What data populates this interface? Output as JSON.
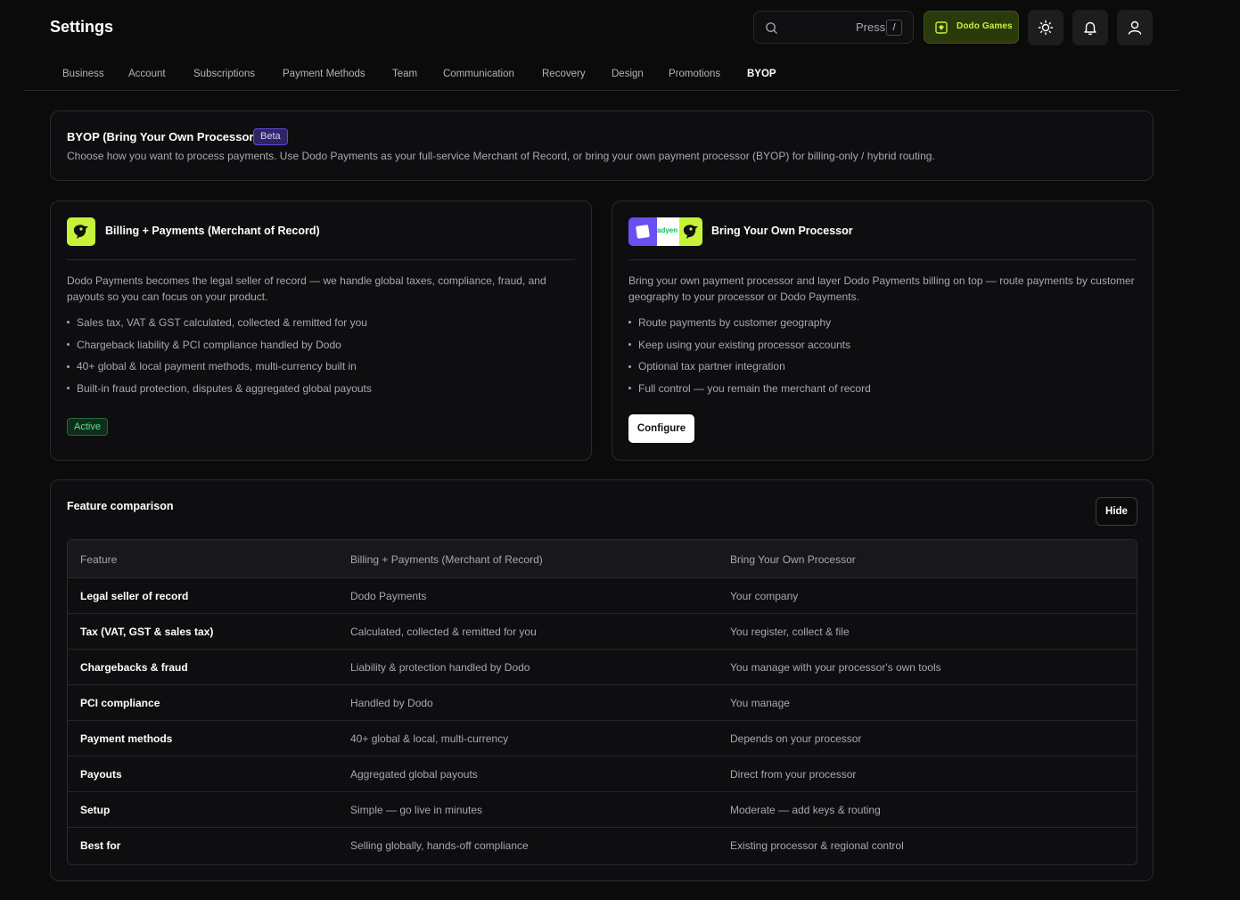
{
  "header": {
    "title": "Settings",
    "search": {
      "hint": "Press",
      "shortcut": "/"
    },
    "workspace": {
      "label": "Dodo Games"
    }
  },
  "tabs": [
    {
      "label": "Business"
    },
    {
      "label": "Account"
    },
    {
      "label": "Subscriptions"
    },
    {
      "label": "Payment Methods"
    },
    {
      "label": "Team"
    },
    {
      "label": "Communication"
    },
    {
      "label": "Recovery"
    },
    {
      "label": "Design"
    },
    {
      "label": "Promotions"
    },
    {
      "label": "BYOP",
      "active": true
    }
  ],
  "intro": {
    "title": "BYOP (Bring Your Own Processor)",
    "badge": "Beta",
    "description": "Choose how you want to process payments. Use Dodo Payments as your full-service Merchant of Record, or bring your own payment processor (BYOP) for billing-only / hybrid routing."
  },
  "options": {
    "mor": {
      "title": "Billing + Payments (Merchant of Record)",
      "description": "Dodo Payments becomes the legal seller of record — we handle global taxes, compliance, fraud, and payouts so you can focus on your product.",
      "bullets": [
        "Sales tax, VAT & GST calculated, collected & remitted for you",
        "Chargeback liability & PCI compliance handled by Dodo",
        "40+ global & local payment methods, multi-currency built in",
        "Built-in fraud protection, disputes & aggregated global payouts"
      ],
      "status": "Active"
    },
    "byop": {
      "title": "Bring Your Own Processor",
      "logo_text": "adyen",
      "description": "Bring your own payment processor and layer Dodo Payments billing on top — route payments by customer geography to your processor or Dodo Payments.",
      "bullets": [
        "Route payments by customer geography",
        "Keep using your existing processor accounts",
        "Optional tax partner integration",
        "Full control — you remain the merchant of record"
      ],
      "button": "Configure"
    }
  },
  "comparison": {
    "title": "Feature comparison",
    "toggle": "Hide",
    "columns": [
      "Feature",
      "Billing + Payments (Merchant of Record)",
      "Bring Your Own Processor"
    ],
    "rows": [
      [
        "Legal seller of record",
        "Dodo Payments",
        "Your company"
      ],
      [
        "Tax (VAT, GST & sales tax)",
        "Calculated, collected & remitted for you",
        "You register, collect & file"
      ],
      [
        "Chargebacks & fraud",
        "Liability & protection handled by Dodo",
        "You manage with your processor's own tools"
      ],
      [
        "PCI compliance",
        "Handled by Dodo",
        "You manage"
      ],
      [
        "Payment methods",
        "40+ global & local, multi-currency",
        "Depends on your processor"
      ],
      [
        "Payouts",
        "Aggregated global payouts",
        "Direct from your processor"
      ],
      [
        "Setup",
        "Simple — go live in minutes",
        "Moderate — add keys & routing"
      ],
      [
        "Best for",
        "Selling globally, hands-off compliance",
        "Existing processor & regional control"
      ]
    ]
  },
  "colors": {
    "background": "#0b0b0c",
    "brand_accent": "#c7f23a",
    "beta_badge": "#5f48d8",
    "active_badge": "#5fe08f"
  },
  "icons": [
    "search-icon",
    "dodo-logo-icon",
    "sun-icon",
    "bell-icon",
    "user-icon",
    "dodo-bird-icon",
    "processor-logo-icon"
  ]
}
